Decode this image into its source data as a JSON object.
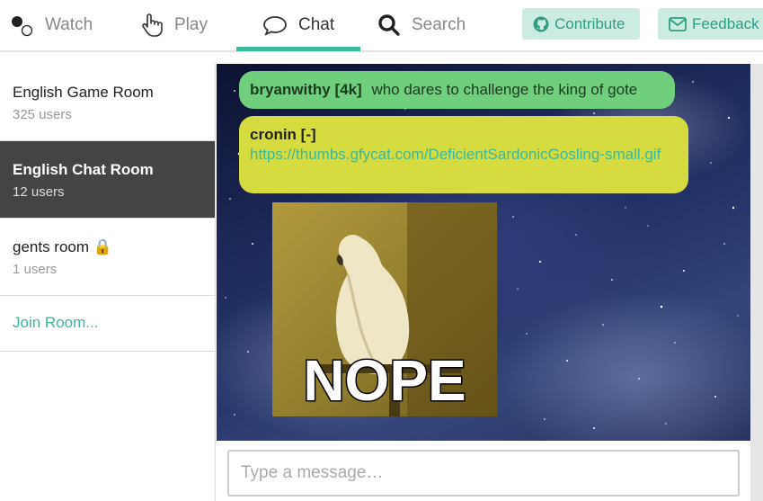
{
  "nav": {
    "watch_label": "Watch",
    "play_label": "Play",
    "chat_label": "Chat",
    "search_label": "Search",
    "active_tab": "Chat",
    "contribute_label": "Contribute",
    "feedback_label": "Feedback"
  },
  "rooms": [
    {
      "name": "English Game Room",
      "users": "325 users",
      "active": false
    },
    {
      "name": "English Chat Room",
      "users": "12 users",
      "active": true
    },
    {
      "name": "gents room 🔒",
      "users": "1 users",
      "active": false
    }
  ],
  "join_label": "Join Room...",
  "messages": [
    {
      "author": "bryanwithy [4k]",
      "text": "who dares to challenge the king of gote"
    },
    {
      "author": "cronin [-]",
      "link": "https://thumbs.gfycat.com/DeficientSardonicGosling-small.gif"
    }
  ],
  "gif": {
    "caption": "NOPE"
  },
  "composer": {
    "placeholder": "Type a message…"
  },
  "colors": {
    "accent": "#3cb89a",
    "msg_green": "#6fcf7c",
    "msg_yellow": "#d6dc3f",
    "active_room": "#444444"
  }
}
